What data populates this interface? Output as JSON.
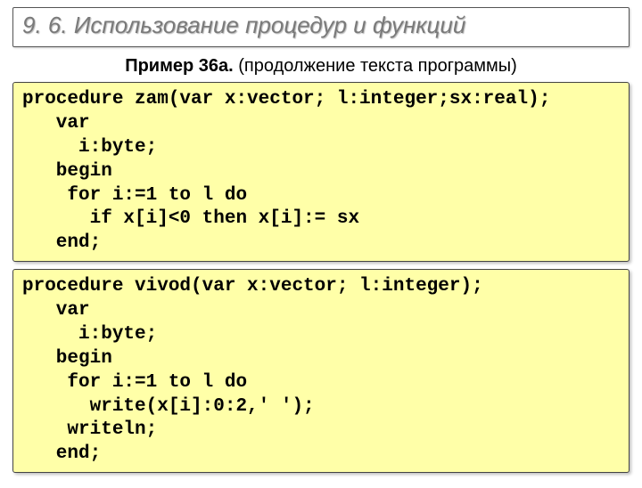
{
  "header": {
    "title": "9. 6. Использование процедур и функций"
  },
  "subtitle": {
    "bold": "Пример 36а.",
    "rest": " (продолжение текста программы)"
  },
  "code": {
    "block1": "procedure zam(var x:vector; l:integer;sx:real);\n   var\n     i:byte;\n   begin\n    for i:=1 to l do\n      if x[i]<0 then x[i]:= sx\n   end;",
    "block2": "procedure vivod(var x:vector; l:integer);\n   var\n     i:byte;\n   begin\n    for i:=1 to l do\n      write(x[i]:0:2,' ');\n    writeln;\n   end;"
  }
}
